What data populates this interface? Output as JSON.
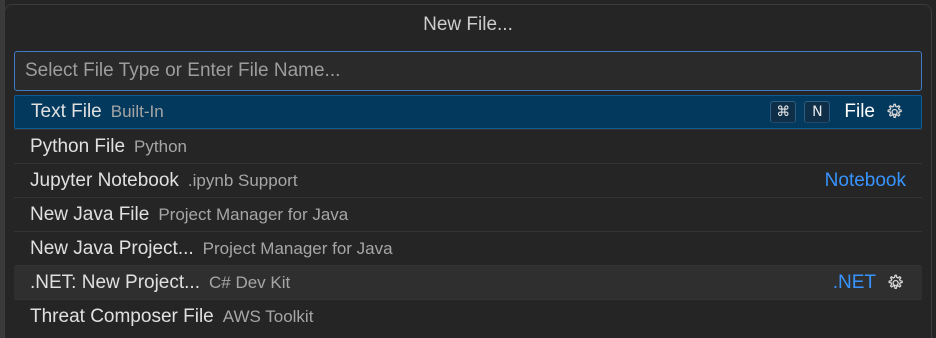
{
  "picker": {
    "title": "New File...",
    "input": {
      "value": "",
      "placeholder": "Select File Type or Enter File Name..."
    },
    "items": [
      {
        "label": "Text File",
        "description": "Built-In",
        "keybinding": [
          "⌘",
          "N"
        ],
        "category": "File",
        "gear": true,
        "state": "selected"
      },
      {
        "label": "Python File",
        "description": "Python",
        "category": "",
        "gear": false,
        "state": ""
      },
      {
        "label": "Jupyter Notebook",
        "description": ".ipynb Support",
        "category": "Notebook",
        "gear": false,
        "state": ""
      },
      {
        "label": "New Java File",
        "description": "Project Manager for Java",
        "category": "",
        "gear": false,
        "state": ""
      },
      {
        "label": "New Java Project...",
        "description": "Project Manager for Java",
        "category": "",
        "gear": false,
        "state": ""
      },
      {
        "label": ".NET: New Project...",
        "description": "C# Dev Kit",
        "category": ".NET",
        "gear": true,
        "state": "hover"
      },
      {
        "label": "Threat Composer File",
        "description": "AWS Toolkit",
        "category": "",
        "gear": false,
        "state": ""
      }
    ]
  },
  "colors": {
    "accent": "#3794ff",
    "selected_bg": "#04395e",
    "focus_border": "#3d7cc4"
  },
  "icons": {
    "item_config": "gear-icon"
  }
}
